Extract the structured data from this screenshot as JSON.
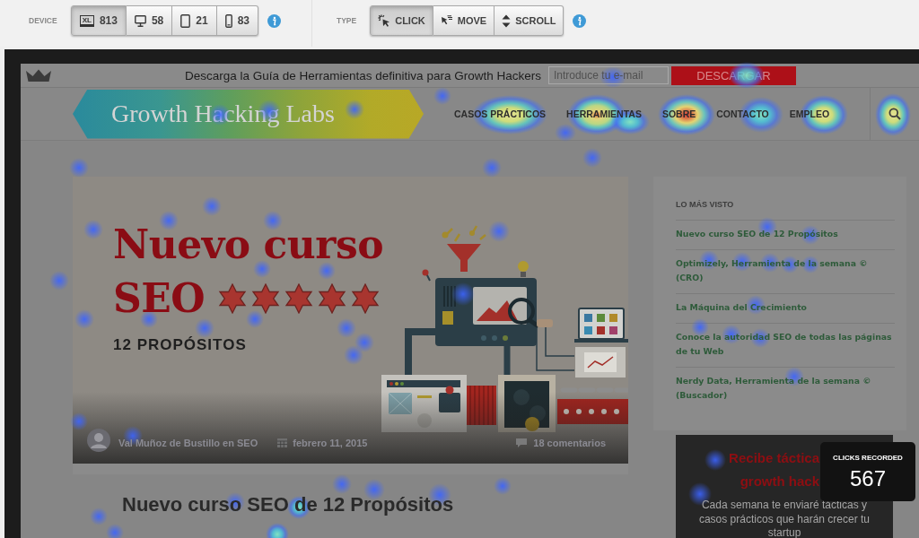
{
  "toolbar": {
    "device": {
      "label": "DEVICE",
      "options": [
        {
          "kind": "xl",
          "icon_label": "XL",
          "count": "813",
          "selected": true
        },
        {
          "kind": "desktop",
          "count": "58",
          "selected": false
        },
        {
          "kind": "tablet",
          "count": "21",
          "selected": false
        },
        {
          "kind": "phone",
          "count": "83",
          "selected": false
        }
      ]
    },
    "type": {
      "label": "TYPE",
      "options": [
        {
          "kind": "click",
          "label": "CLICK",
          "selected": true
        },
        {
          "kind": "move",
          "label": "MOVE",
          "selected": false
        },
        {
          "kind": "scroll",
          "label": "SCROLL",
          "selected": false
        }
      ]
    }
  },
  "site": {
    "promo_bar": {
      "text": "Descarga la Guía de Herramientas definitiva para Growth Hackers",
      "email_field": {
        "placeholder": "Introduce tu e-mail"
      },
      "button": "DESCARGAR"
    },
    "logo": "Growth Hacking Labs",
    "nav": [
      "CASOS PRÁCTICOS",
      "HERRAMIENTAS",
      "SOBRE",
      "CONTACTO",
      "EMPLEO"
    ],
    "featured_post": {
      "banner": {
        "headline": "Nuevo curso",
        "headline_2": "SEO",
        "stars": 5,
        "subtitle": "12 PROPÓSITOS"
      },
      "author": "Val Muñoz de Bustillo en SEO",
      "date": "febrero 11, 2015",
      "comments": "18 comentarios",
      "title": "Nuevo curso SEO de 12 Propósitos"
    },
    "sidebar": {
      "heading": "LO MÁS VISTO",
      "links": [
        "Nuevo curso SEO de 12 Propósitos",
        "Optimizely, Herramienta de la semana © (CRO)",
        "La Máquina del Crecimiento",
        "Conoce la autoridad SEO de todas las páginas de tu Web",
        "Nerdy Data, Herramienta de la semana © (Buscador)"
      ]
    },
    "subscribe": {
      "title_lines": [
        "Recibe táctica",
        "growth hack"
      ],
      "text": "Cada semana te enviaré tácticas y casos prácticos que harán crecer tu startup"
    }
  },
  "clicks_badge": {
    "label": "CLICKS RECORDED",
    "count": "567"
  }
}
